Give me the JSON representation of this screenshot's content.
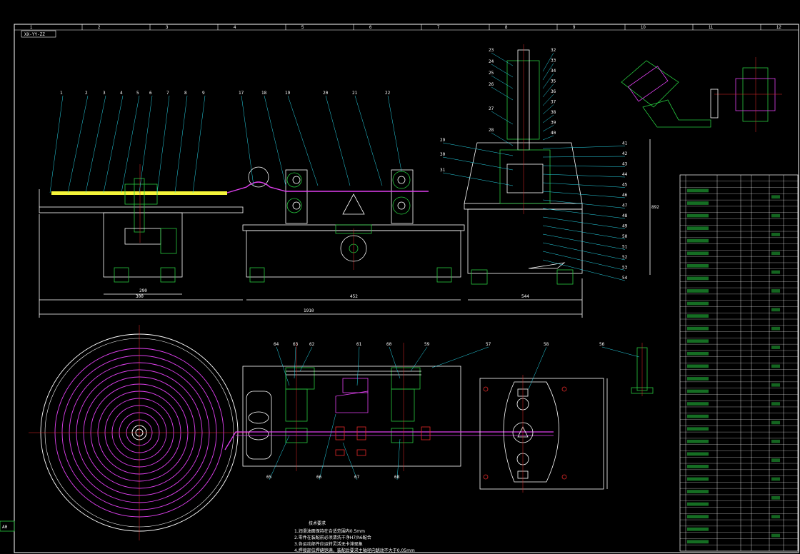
{
  "drawing": {
    "grid_numbers": [
      "1",
      "2",
      "3",
      "4",
      "5",
      "6",
      "7",
      "8",
      "9",
      "10",
      "11",
      "12"
    ],
    "drawing_code": "XX-YY-ZZ",
    "left_stamp": "A0",
    "colors": {
      "background": "#000000",
      "line": "#ffffff",
      "green": "#27c93f",
      "cyan": "#27d6e8",
      "magenta": "#e040f0",
      "yellow": "#f5f53a",
      "red": "#e52a2a",
      "white": "#ffffff"
    },
    "elevation_callouts": [
      "1",
      "2",
      "3",
      "4",
      "5",
      "6",
      "7",
      "8",
      "9",
      "17",
      "18",
      "19",
      "20",
      "21",
      "22",
      "23",
      "24",
      "25",
      "26",
      "27",
      "28",
      "29",
      "30",
      "31",
      "32",
      "33",
      "34",
      "35",
      "36",
      "37",
      "38",
      "39",
      "40",
      "41",
      "42",
      "43",
      "44",
      "45",
      "46",
      "47",
      "48",
      "49",
      "50",
      "51",
      "52",
      "53",
      "54"
    ],
    "dimensions": [
      "290",
      "452",
      "300",
      "1910",
      "892",
      "544"
    ],
    "plan_callouts": [
      "56",
      "58",
      "57",
      "59",
      "60",
      "61",
      "62",
      "63",
      "64",
      "65",
      "66",
      "67",
      "68"
    ],
    "notes": {
      "title": "技术要求",
      "lines": [
        "1.润滑油面保持在合适范围内0.5mm",
        "2.零件在装配前必须清洗干净H7/h6配合",
        "3.各运动部件应运转灵活无卡滞现象",
        "4.焊接部位焊缝饱满，装配后要求主轴径向跳动不大于0.05mm"
      ]
    },
    "bom_rows": 60
  }
}
